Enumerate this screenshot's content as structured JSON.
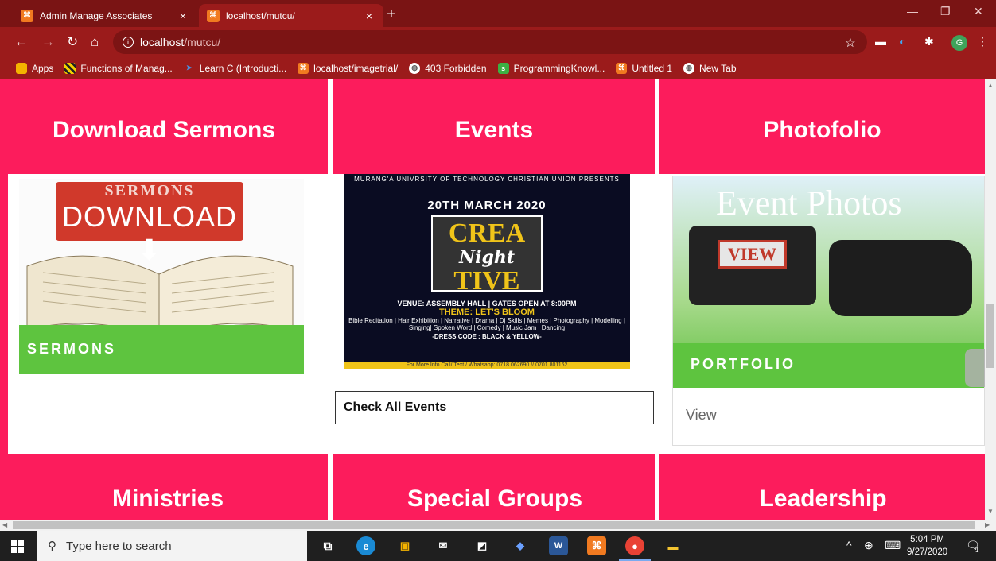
{
  "browser": {
    "tabs": [
      {
        "title": "Admin Manage Associates",
        "favicon": "xampp-icon",
        "active": false
      },
      {
        "title": "localhost/mutcu/",
        "favicon": "xampp-icon",
        "active": true
      }
    ],
    "close_glyph": "×",
    "new_tab_glyph": "+",
    "url_host": "localhost",
    "url_path": "/mutcu/",
    "profile_initial": "G",
    "bookmarks": [
      {
        "label": "Apps",
        "icon": "apps-grid-icon",
        "color": "#f4b400"
      },
      {
        "label": "Functions of Manag...",
        "icon": "stripes-icon",
        "color": "#f4d000"
      },
      {
        "label": "Learn C (Introducti...",
        "icon": "arrow-icon",
        "color": "#4a90e2"
      },
      {
        "label": "localhost/imagetrial/",
        "icon": "xampp-icon",
        "color": "#f17a20"
      },
      {
        "label": "403 Forbidden",
        "icon": "globe-icon",
        "color": "#ffffff"
      },
      {
        "label": "ProgrammingKnowl...",
        "icon": "pk-icon",
        "color": "#3cb043"
      },
      {
        "label": "Untitled 1",
        "icon": "xampp-icon",
        "color": "#f17a20"
      },
      {
        "label": "New Tab",
        "icon": "globe-icon",
        "color": "#ffffff"
      }
    ]
  },
  "page": {
    "cards": [
      {
        "title": "Download Sermons"
      },
      {
        "title": "Events"
      },
      {
        "title": "Photofolio"
      }
    ],
    "sermons_image": {
      "line1": "SERMONS",
      "line2": "DOWNLOAD",
      "strip": "SERMONS"
    },
    "events_poster": {
      "header": "MURANG'A UNIVRSITY OF TECHNOLOGY CHRISTIAN UNION PRESENTS",
      "date": "20TH MARCH 2020",
      "logo_top": "CREA",
      "logo_mid": "Night",
      "logo_bot": "TIVE",
      "venue": "VENUE: ASSEMBLY HALL | GATES OPEN AT 8:00PM",
      "theme": "THEME: LET'S BLOOM",
      "performances": "Bible Recitation | Hair Exhibition | Narrative | Drama | Dj Skills | Memes | Photography | Modelling | Singing| Spoken Word | Comedy | Music Jam | Dancing",
      "dress_code": "-DRESS CODE : BLACK & YELLOW-",
      "footer": "For More Info Call/ Text / Whatsapp: 0718 062690 // 0701 801162"
    },
    "events_button": "Check All Events",
    "photofolio_image": {
      "title": "Event Photos",
      "view": "VIEW",
      "strip": "PORTFOLIO"
    },
    "photofolio_link": "View",
    "row2_titles": [
      "Ministries",
      "Special Groups",
      "Leadership"
    ]
  },
  "taskbar": {
    "search_placeholder": "Type here to search",
    "time": "5:04 PM",
    "date": "9/27/2020",
    "notification_count": "1"
  },
  "colors": {
    "accent": "#fc1c5c",
    "browser": "#9b1b1b",
    "green": "#5ec43f"
  }
}
